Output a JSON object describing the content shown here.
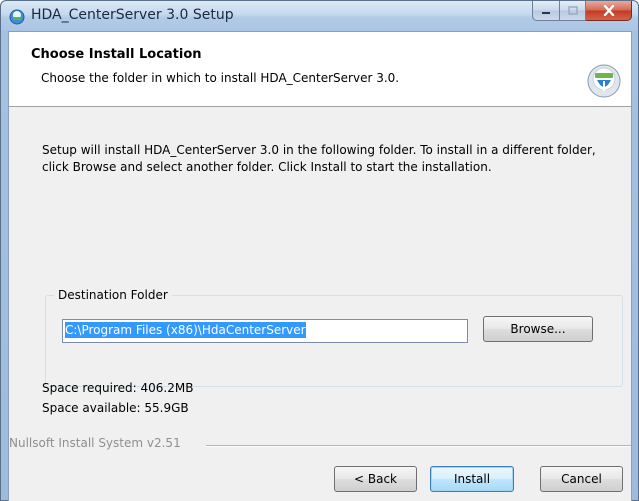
{
  "window": {
    "title": "HDA_CenterServer 3.0 Setup"
  },
  "header": {
    "title": "Choose Install Location",
    "subtitle": "Choose the folder in which to install HDA_CenterServer 3.0."
  },
  "body": {
    "line1": "Setup will install HDA_CenterServer 3.0 in the following folder. To install in a different folder,",
    "line2": "click Browse and select another folder. Click Install to start the installation."
  },
  "destination": {
    "legend": "Destination Folder",
    "path": "C:\\Program Files (x86)\\HdaCenterServer",
    "browse_label": "Browse..."
  },
  "space": {
    "required": "Space required: 406.2MB",
    "available": "Space available: 55.9GB"
  },
  "footer": {
    "branding": "Nullsoft Install System v2.51",
    "back_label": "< Back",
    "install_label": "Install",
    "cancel_label": "Cancel"
  },
  "colors": {
    "selection": "#3399ff",
    "close_button": "#c23c22"
  }
}
